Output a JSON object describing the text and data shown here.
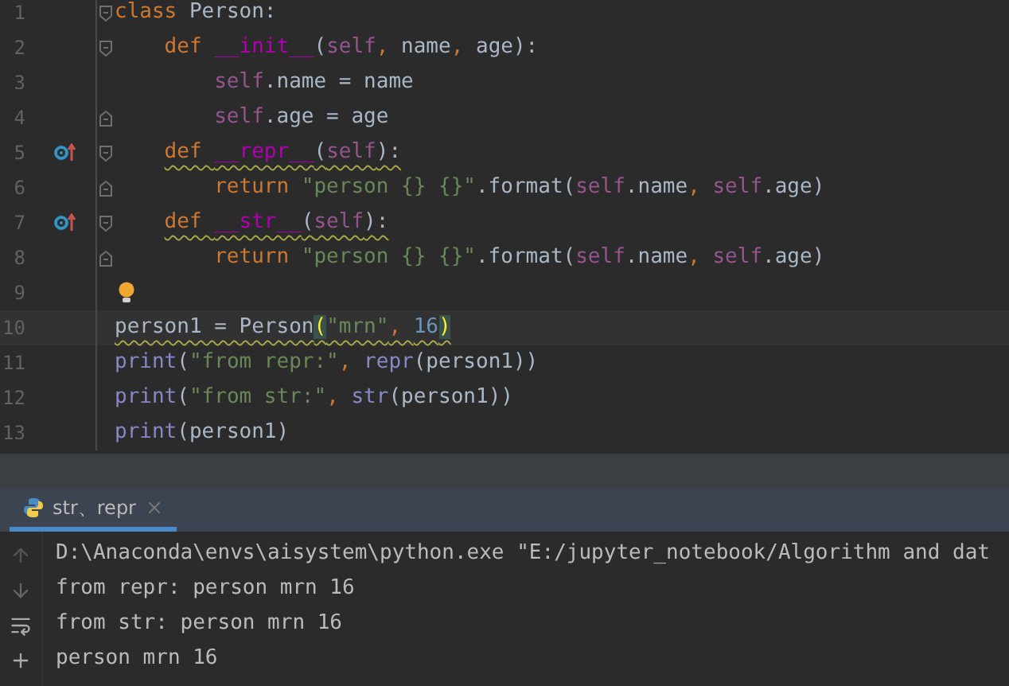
{
  "editor": {
    "lines": [
      {
        "number": "1",
        "fold_open": true,
        "tokens": [
          {
            "kind": "keyword",
            "text": "class"
          },
          {
            "kind": "plain",
            "text": " Person:"
          }
        ],
        "children": [
          {
            "number": "2",
            "fold_open": true,
            "tokens": [
              {
                "kind": "keyword",
                "text": "def "
              },
              {
                "kind": "magic",
                "text": "__init__"
              },
              {
                "kind": "plain",
                "text": "("
              },
              {
                "kind": "self",
                "text": "self"
              },
              {
                "kind": "keyword",
                "text": ", "
              },
              {
                "kind": "plain",
                "text": "name"
              },
              {
                "kind": "keyword",
                "text": ", "
              },
              {
                "kind": "plain",
                "text": "age):"
              }
            ],
            "children": [
              {
                "number": "3",
                "tokens": [
                  {
                    "kind": "self",
                    "text": "self"
                  },
                  {
                    "kind": "plain",
                    "text": ".name = name"
                  }
                ]
              },
              {
                "number": "4",
                "fold_close": true,
                "tokens": [
                  {
                    "kind": "self",
                    "text": "self"
                  },
                  {
                    "kind": "plain",
                    "text": ".age = age"
                  }
                ]
              }
            ]
          },
          {
            "number": "5",
            "fold_open": true,
            "override": true,
            "warning": true,
            "tokens": [
              {
                "kind": "keyword",
                "text": "def "
              },
              {
                "kind": "magic",
                "text": "__repr__"
              },
              {
                "kind": "plain",
                "text": "("
              },
              {
                "kind": "self",
                "text": "self"
              },
              {
                "kind": "plain",
                "text": "):"
              }
            ],
            "children": [
              {
                "number": "6",
                "fold_close": true,
                "tokens": [
                  {
                    "kind": "keyword",
                    "text": "return "
                  },
                  {
                    "kind": "string",
                    "text": "\"person {} {}\""
                  },
                  {
                    "kind": "plain",
                    "text": ".format("
                  },
                  {
                    "kind": "self",
                    "text": "self"
                  },
                  {
                    "kind": "plain",
                    "text": ".name"
                  },
                  {
                    "kind": "keyword",
                    "text": ", "
                  },
                  {
                    "kind": "self",
                    "text": "self"
                  },
                  {
                    "kind": "plain",
                    "text": ".age)"
                  }
                ]
              }
            ]
          },
          {
            "number": "7",
            "fold_open": true,
            "override": true,
            "warning": true,
            "tokens": [
              {
                "kind": "keyword",
                "text": "def "
              },
              {
                "kind": "magic",
                "text": "__str__"
              },
              {
                "kind": "plain",
                "text": "("
              },
              {
                "kind": "self",
                "text": "self"
              },
              {
                "kind": "plain",
                "text": "):"
              }
            ],
            "children": [
              {
                "number": "8",
                "fold_close": true,
                "tokens": [
                  {
                    "kind": "keyword",
                    "text": "return "
                  },
                  {
                    "kind": "string",
                    "text": "\"person {} {}\""
                  },
                  {
                    "kind": "plain",
                    "text": ".format("
                  },
                  {
                    "kind": "self",
                    "text": "self"
                  },
                  {
                    "kind": "plain",
                    "text": ".name"
                  },
                  {
                    "kind": "keyword",
                    "text": ", "
                  },
                  {
                    "kind": "self",
                    "text": "self"
                  },
                  {
                    "kind": "plain",
                    "text": ".age)"
                  }
                ]
              }
            ]
          }
        ]
      },
      {
        "number": "9",
        "bulb": true
      },
      {
        "number": "10",
        "current": true,
        "warning": true,
        "tokens": [
          {
            "kind": "plain",
            "text": "person1 = Person"
          },
          {
            "kind": "brace",
            "text": "("
          },
          {
            "kind": "string",
            "text": "\"mrn\""
          },
          {
            "kind": "keyword",
            "text": ", "
          },
          {
            "kind": "number",
            "text": "16"
          },
          {
            "kind": "brace",
            "text": ")"
          }
        ]
      },
      {
        "number": "11",
        "tokens": [
          {
            "kind": "builtin",
            "text": "print"
          },
          {
            "kind": "plain",
            "text": "("
          },
          {
            "kind": "string",
            "text": "\"from repr:\""
          },
          {
            "kind": "keyword",
            "text": ", "
          },
          {
            "kind": "builtin",
            "text": "repr"
          },
          {
            "kind": "plain",
            "text": "(person1))"
          }
        ]
      },
      {
        "number": "12",
        "tokens": [
          {
            "kind": "builtin",
            "text": "print"
          },
          {
            "kind": "plain",
            "text": "("
          },
          {
            "kind": "string",
            "text": "\"from str:\""
          },
          {
            "kind": "keyword",
            "text": ", "
          },
          {
            "kind": "builtin",
            "text": "str"
          },
          {
            "kind": "plain",
            "text": "(person1))"
          }
        ]
      },
      {
        "number": "13",
        "tokens": [
          {
            "kind": "builtin",
            "text": "print"
          },
          {
            "kind": "plain",
            "text": "(person1)"
          }
        ]
      }
    ]
  },
  "run_panel": {
    "tabs": [
      {
        "label": "str、repr",
        "selected": true
      }
    ],
    "output": [
      "D:\\Anaconda\\envs\\aisystem\\python.exe \"E:/jupyter_notebook/Algorithm and dat",
      "from repr: person mrn 16",
      "from str: person mrn 16",
      "person mrn 16"
    ]
  }
}
